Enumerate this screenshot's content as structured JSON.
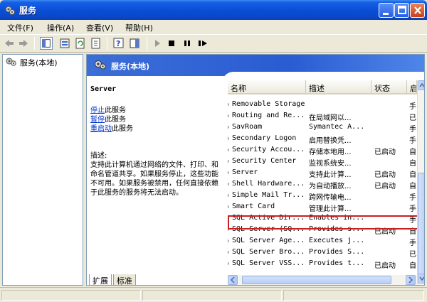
{
  "window": {
    "title": "服务"
  },
  "menu": [
    {
      "label": "文件(F)"
    },
    {
      "label": "操作(A)"
    },
    {
      "label": "查看(V)"
    },
    {
      "label": "帮助(H)"
    }
  ],
  "tree": {
    "root_label": "服务(本地)"
  },
  "pane": {
    "title": "服务(本地)"
  },
  "details": {
    "service_name": "Server",
    "actions": [
      {
        "link": "停止",
        "rest": "此服务"
      },
      {
        "link": "暂停",
        "rest": "此服务"
      },
      {
        "link": "重启动",
        "rest": "此服务"
      }
    ],
    "desc_label": "描述:",
    "desc_text": "支持此计算机通过网络的文件、打印、和命名管道共享。如果服务停止，这些功能不可用。如果服务被禁用，任何直接依赖于此服务的服务将无法启动。"
  },
  "list": {
    "columns": [
      "名称",
      "描述",
      "状态",
      "启"
    ],
    "rows": [
      {
        "name": "Removable Storage",
        "desc": "",
        "status": "",
        "start": "手"
      },
      {
        "name": "Routing and Re...",
        "desc": "在局域网以...",
        "status": "",
        "start": "已"
      },
      {
        "name": "SavRoam",
        "desc": "Symantec A...",
        "status": "",
        "start": "手"
      },
      {
        "name": "Secondary Logon",
        "desc": "启用替换凭...",
        "status": "",
        "start": "手"
      },
      {
        "name": "Security Accou...",
        "desc": "存储本地用...",
        "status": "已启动",
        "start": "自"
      },
      {
        "name": "Security Center",
        "desc": "监视系统安...",
        "status": "",
        "start": "自"
      },
      {
        "name": "Server",
        "desc": "支持此计算...",
        "status": "已启动",
        "start": "自"
      },
      {
        "name": "Shell Hardware...",
        "desc": "为自动播放...",
        "status": "已启动",
        "start": "自"
      },
      {
        "name": "Simple Mail Tr...",
        "desc": "跨网传输电...",
        "status": "",
        "start": "手"
      },
      {
        "name": "Smart Card",
        "desc": "管理此计算...",
        "status": "",
        "start": "手"
      },
      {
        "name": "SQL Active Dir...",
        "desc": "Enables in...",
        "status": "",
        "start": "手"
      },
      {
        "name": "SQL Server (SQ...",
        "desc": "Provides s...",
        "status": "已启动",
        "start": "自"
      },
      {
        "name": "SQL Server Age...",
        "desc": "Executes j...",
        "status": "",
        "start": "手"
      },
      {
        "name": "SQL Server Bro...",
        "desc": "Provides S...",
        "status": "",
        "start": "已"
      },
      {
        "name": "SQL Server VSS...",
        "desc": "Provides t...",
        "status": "已启动",
        "start": "自"
      }
    ],
    "selected_row": "Server"
  },
  "tabs": [
    {
      "label": "扩展"
    },
    {
      "label": "标准"
    }
  ],
  "colors": {
    "title_bar": "#0a4fd6",
    "pane_header": "#2a5cd2",
    "highlight": "#c8201e",
    "link": "#0033cc"
  }
}
